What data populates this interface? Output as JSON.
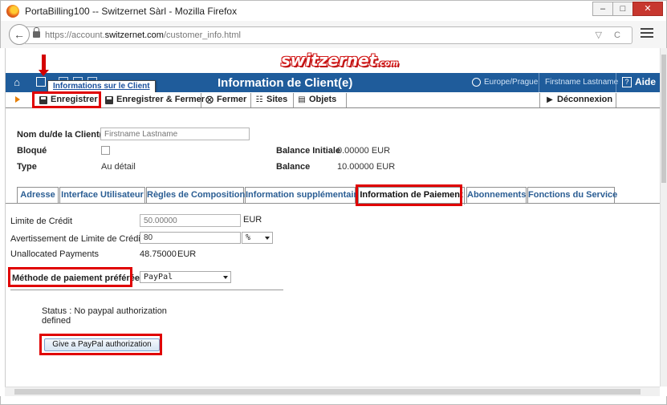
{
  "window": {
    "title": "PortaBilling100 -- Switzernet Sàrl - Mozilla Firefox",
    "minimize": "–",
    "maximize": "□",
    "close": "✕"
  },
  "browser": {
    "url_prefix": "https://account.",
    "url_domain": "switzernet.com",
    "url_path": "/customer_info.html",
    "url_icons": "▽ C"
  },
  "logo": {
    "name": "switzernet",
    "suffix": ".com"
  },
  "header": {
    "page_title": "Information de Client(e)",
    "timezone": "Europe/Prague",
    "user": "Firstname Lastname",
    "help": "Aide",
    "help_glyph": "?",
    "tooltip": "Informations sur le Client"
  },
  "toolbar": {
    "save": "Enregistrer",
    "save_close": "Enregistrer & Fermer",
    "close": "Fermer",
    "sites": "Sites",
    "objects": "Objets",
    "logout": "Déconnexion"
  },
  "client": {
    "name_label": "Nom du/de la Client(e)",
    "name_placeholder": "Firstname Lastname",
    "blocked_label": "Bloqué",
    "type_label": "Type",
    "type_value": "Au détail",
    "initial_balance_label": "Balance Initiale",
    "initial_balance_value": "0.00000 EUR",
    "balance_label": "Balance",
    "balance_value": "10.00000 EUR"
  },
  "tabs": [
    {
      "label": "Adresse"
    },
    {
      "label": "Interface Utilisateur"
    },
    {
      "label": "Règles de Composition"
    },
    {
      "label": "Information supplémentaire"
    },
    {
      "label": "Information de Paiement"
    },
    {
      "label": "Abonnements"
    },
    {
      "label": "Fonctions du Service"
    }
  ],
  "payment": {
    "credit_limit_label": "Limite de Crédit",
    "credit_limit_placeholder": "50.00000",
    "credit_limit_currency": "EUR",
    "credit_warning_label": "Avertissement de Limite de Crédit",
    "credit_warning_value": "80",
    "credit_warning_unit": "%",
    "unallocated_label": "Unallocated Payments",
    "unallocated_value": "48.75000",
    "unallocated_currency": "EUR",
    "method_label": "Méthode de paiement préférée",
    "method_value": "PayPal",
    "status_line1": "Status : No paypal authorization",
    "status_line2": "defined",
    "paypal_button": "Give a PayPal authorization"
  },
  "colors": {
    "header_blue": "#1f5c9b",
    "highlight_red": "#e00000",
    "tab_text_blue": "#2a5d93"
  }
}
